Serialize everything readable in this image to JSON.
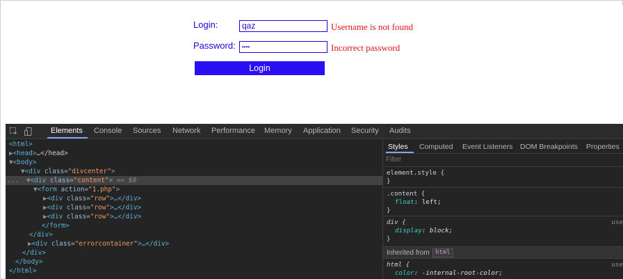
{
  "form": {
    "login_label": "Login:",
    "login_value": "qaz",
    "login_error": "Username is not found",
    "password_label": "Password:",
    "password_value": "••••",
    "password_error": "Incorrect password",
    "submit_label": "Login"
  },
  "devtools": {
    "tabs": [
      "Elements",
      "Console",
      "Sources",
      "Network",
      "Performance",
      "Memory",
      "Application",
      "Security",
      "Audits"
    ],
    "active_tab": "Elements",
    "dom": {
      "l1": "<html>",
      "l2_tag": "<head>",
      "l2_rest": "…</head>",
      "l3": "<body>",
      "l4_open": "<div ",
      "l4_attr": "class=",
      "l4_val": "\"divcenter\"",
      "l4_close": ">",
      "l5_open": "<div ",
      "l5_attr": "class=",
      "l5_val": "\"content\"",
      "l5_close": ">",
      "l5_marker": " == $0",
      "l6_open": "<form ",
      "l6_attr": "action=",
      "l6_val": "\"1.php\"",
      "l6_close": ">",
      "row_open": "<div ",
      "row_attr": "class=",
      "row_val": "\"row\"",
      "row_close": ">…</div>",
      "l10": "</form>",
      "l11": "</div>",
      "l12_open": "<div ",
      "l12_attr": "class=",
      "l12_val": "\"errorcontainer\"",
      "l12_close": ">…</div>",
      "l13": "</div>",
      "l14": "</body>",
      "l15": "</html>",
      "ellipsis": "..."
    },
    "styles_tabs": [
      "Styles",
      "Computed",
      "Event Listeners",
      "DOM Breakpoints",
      "Properties"
    ],
    "filter_placeholder": "Filter",
    "rules": {
      "r1_selector": "element.style {",
      "r1_close": "}",
      "r2_selector": ".content {",
      "r2_prop": "float",
      "r2_value": "left;",
      "r2_close": "}",
      "r3_selector": "div {",
      "r3_prop": "display",
      "r3_value": "block;",
      "r3_close": "}",
      "r3_source": "use",
      "inherited_label": "Inherited from",
      "inherited_chip": "html",
      "r4_selector": "html {",
      "r4_prop": "color",
      "r4_value": "-internal-root-color;",
      "r4_source": "use"
    }
  },
  "colors": {
    "form_blue": "#2200dd",
    "error_red": "#e0131a",
    "button_blue": "#2a0ff5",
    "devtools_bg": "#242424",
    "accent": "#7da6ff"
  }
}
